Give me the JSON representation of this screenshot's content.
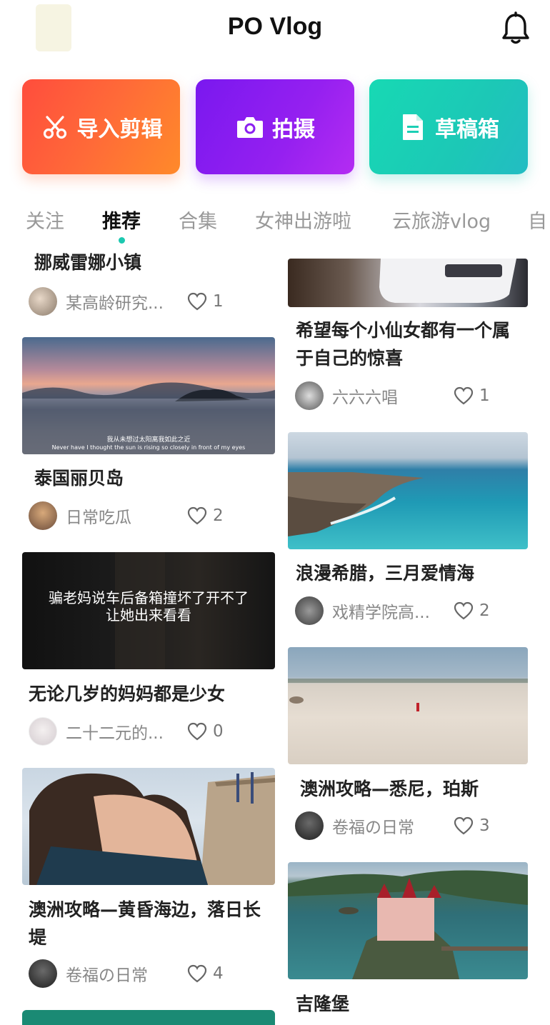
{
  "header": {
    "title": "PO Vlog",
    "bell_icon": "bell-icon"
  },
  "actions": [
    {
      "label": "导入剪辑",
      "icon": "scissors-icon",
      "color": "#ff5a36"
    },
    {
      "label": "拍摄",
      "icon": "camera-icon",
      "color": "#8b1ff0"
    },
    {
      "label": "草稿箱",
      "icon": "document-icon",
      "color": "#1ccfb5"
    }
  ],
  "tabs": [
    {
      "label": "关注"
    },
    {
      "label": "推荐"
    },
    {
      "label": "合集"
    },
    {
      "label": "女神出游啦"
    },
    {
      "label": "云旅游vlog"
    },
    {
      "label": "自"
    }
  ],
  "feed": {
    "left": [
      {
        "title": "挪威雷娜小镇",
        "author": "某高龄研究...",
        "likes": "1"
      },
      {
        "title": "泰国丽贝岛",
        "author": "日常吃瓜",
        "likes": "2",
        "caption_cn": "我从未想过太阳离我如此之近",
        "caption_en": "Never have I thought the sun is rising so closely in front of my eyes"
      },
      {
        "title": "无论几岁的妈妈都是少女",
        "author": "二十二元的...",
        "likes": "0",
        "caption": "骗老妈说车后备箱撞坏了开不了让她出来看看"
      },
      {
        "title": "澳洲攻略—黄昏海边，落日长堤",
        "author": "卷福の日常",
        "likes": "4"
      }
    ],
    "right": [
      {
        "title": "希望每个小仙女都有一个属于自己的惊喜",
        "author": "六六六唱",
        "likes": "1"
      },
      {
        "title": "浪漫希腊，三月爱情海",
        "author": "戏精学院高...",
        "likes": "2"
      },
      {
        "title": "澳洲攻略—悉尼，珀斯",
        "author": "卷福の日常",
        "likes": "3"
      },
      {
        "title": "吉隆堡"
      }
    ]
  }
}
